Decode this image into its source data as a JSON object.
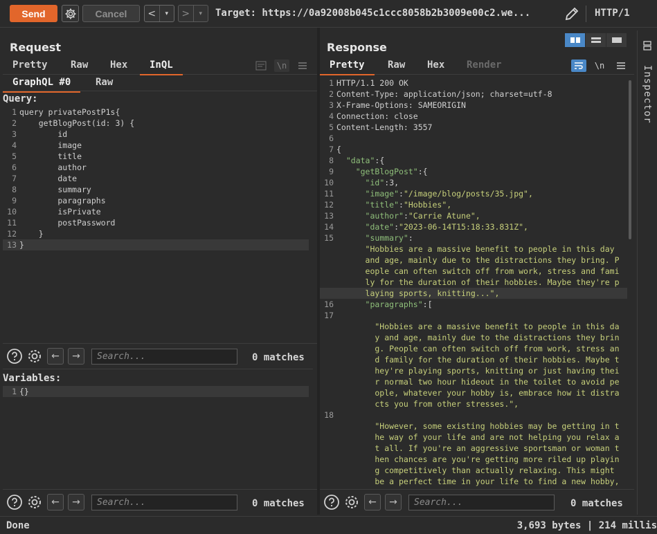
{
  "toolbar": {
    "send_label": "Send",
    "cancel_label": "Cancel",
    "back_label": "<",
    "back_menu": "▾",
    "forward_label": ">",
    "forward_menu": "▾",
    "target_text": "Target: https://0a92008b045c1ccc8058b2b3009e00c2.we...",
    "http_version": "HTTP/1"
  },
  "request": {
    "title": "Request",
    "tabs": [
      "Pretty",
      "Raw",
      "Hex",
      "InQL"
    ],
    "active_tab": "InQL",
    "subtabs": [
      "GraphQL #0",
      "Raw"
    ],
    "query_label": "Query:",
    "query_lines": [
      {
        "n": "1",
        "text": "query privatePostP1s{"
      },
      {
        "n": "2",
        "text": "    getBlogPost(id: 3) {"
      },
      {
        "n": "3",
        "text": "        id"
      },
      {
        "n": "4",
        "text": "        image"
      },
      {
        "n": "5",
        "text": "        title"
      },
      {
        "n": "6",
        "text": "        author"
      },
      {
        "n": "7",
        "text": "        date"
      },
      {
        "n": "8",
        "text": "        summary"
      },
      {
        "n": "9",
        "text": "        paragraphs"
      },
      {
        "n": "10",
        "text": "        isPrivate"
      },
      {
        "n": "11",
        "text": "        postPassword"
      },
      {
        "n": "12",
        "text": "    }"
      },
      {
        "n": "13",
        "text": "}"
      }
    ],
    "variables_label": "Variables:",
    "variables_lines": [
      {
        "n": "1",
        "text": "{}"
      }
    ],
    "search_placeholder": "Search...",
    "matches_top": "0 matches",
    "matches_bottom": "0 matches"
  },
  "response": {
    "title": "Response",
    "tabs": [
      "Pretty",
      "Raw",
      "Hex",
      "Render"
    ],
    "active_tab": "Pretty",
    "newline_label": "\\n",
    "lines": [
      {
        "n": "1",
        "text": "HTTP/1.1 200 OK"
      },
      {
        "n": "2",
        "text": "Content-Type: application/json; charset=utf-8"
      },
      {
        "n": "3",
        "text": "X-Frame-Options: SAMEORIGIN"
      },
      {
        "n": "4",
        "text": "Connection: close"
      },
      {
        "n": "5",
        "text": "Content-Length: 3557"
      },
      {
        "n": "6",
        "text": ""
      },
      {
        "n": "7",
        "text": "{"
      },
      {
        "n": "8",
        "text": "  \"data\":{"
      },
      {
        "n": "9",
        "text": "    \"getBlogPost\":{"
      },
      {
        "n": "10",
        "text": "      \"id\":3,"
      },
      {
        "n": "11",
        "text": "      \"image\":\"/image/blog/posts/35.jpg\","
      },
      {
        "n": "12",
        "text": "      \"title\":\"Hobbies\","
      },
      {
        "n": "13",
        "text": "      \"author\":\"Carrie Atune\","
      },
      {
        "n": "14",
        "text": "      \"date\":\"2023-06-14T15:18:33.831Z\","
      },
      {
        "n": "15",
        "text": "      \"summary\":"
      },
      {
        "n": "",
        "text": "      \"Hobbies are a massive benefit to people in this day"
      },
      {
        "n": "",
        "text": "      and age, mainly due to the distractions they bring. P"
      },
      {
        "n": "",
        "text": "      eople can often switch off from work, stress and fami"
      },
      {
        "n": "",
        "text": "      ly for the duration of their hobbies. Maybe they're p"
      },
      {
        "n": "",
        "text": "      laying sports, knitting...\","
      },
      {
        "n": "16",
        "text": "      \"paragraphs\":["
      },
      {
        "n": "17",
        "text": ""
      },
      {
        "n": "",
        "text": "        \"Hobbies are a massive benefit to people in this da"
      },
      {
        "n": "",
        "text": "        y and age, mainly due to the distractions they brin"
      },
      {
        "n": "",
        "text": "        g. People can often switch off from work, stress an"
      },
      {
        "n": "",
        "text": "        d family for the duration of their hobbies. Maybe t"
      },
      {
        "n": "",
        "text": "        hey're playing sports, knitting or just having thei"
      },
      {
        "n": "",
        "text": "        r normal two hour hideout in the toilet to avoid pe"
      },
      {
        "n": "",
        "text": "        ople, whatever your hobby is, embrace how it distra"
      },
      {
        "n": "",
        "text": "        cts you from other stresses.\","
      },
      {
        "n": "18",
        "text": ""
      },
      {
        "n": "",
        "text": "        \"However, some existing hobbies may be getting in t"
      },
      {
        "n": "",
        "text": "        he way of your life and are not helping you relax a"
      },
      {
        "n": "",
        "text": "        t all. If you're an aggressive sportsman or woman t"
      },
      {
        "n": "",
        "text": "        hen chances are you're getting more riled up playin"
      },
      {
        "n": "",
        "text": "        g competitively than actually relaxing. This might"
      },
      {
        "n": "",
        "text": "        be a perfect time in your life to find a new hobby,"
      }
    ],
    "search_placeholder": "Search...",
    "matches": "0 matches"
  },
  "inspector": {
    "label": "Inspector"
  },
  "status": {
    "text": "Done",
    "info": "3,693 bytes | 214 millis"
  },
  "colors": {
    "accent": "#e2662b",
    "active_layout": "#4a88c7"
  }
}
